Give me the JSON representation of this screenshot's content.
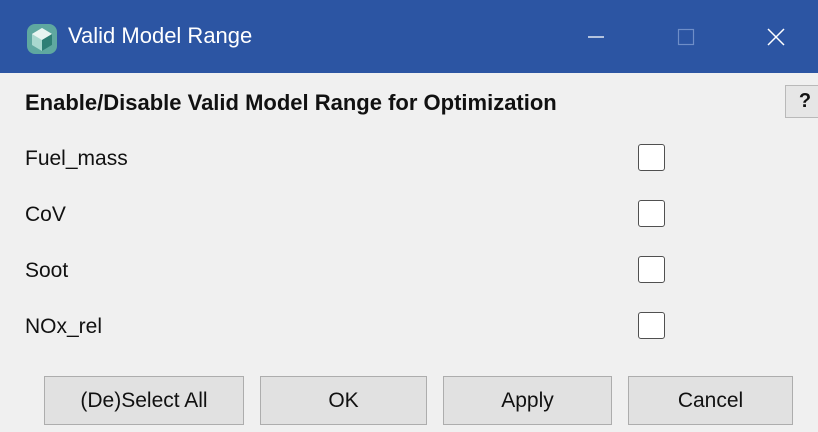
{
  "window": {
    "title": "Valid Model Range",
    "title_bar_color": "#2c55a3",
    "icon": "app-logo-icon",
    "controls": {
      "minimize_icon": "minimize-icon",
      "maximize_icon": "maximize-icon",
      "close_icon": "close-icon"
    }
  },
  "header": {
    "title": "Enable/Disable Valid Model Range for Optimization",
    "help_label": "?"
  },
  "items": [
    {
      "label": "Fuel_mass",
      "checked": false
    },
    {
      "label": "CoV",
      "checked": false
    },
    {
      "label": "Soot",
      "checked": false
    },
    {
      "label": "NOx_rel",
      "checked": false
    }
  ],
  "buttons": {
    "select_all": "(De)Select All",
    "ok": "OK",
    "apply": "Apply",
    "cancel": "Cancel"
  }
}
